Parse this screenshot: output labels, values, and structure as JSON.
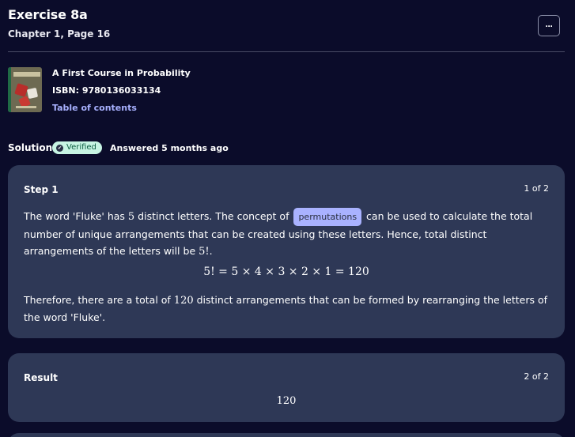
{
  "header": {
    "title": "Exercise 8a",
    "subtitle": "Chapter 1, Page 16",
    "more_label": "···"
  },
  "book": {
    "title": "A First Course in Probability",
    "isbn": "ISBN: 9780136033134",
    "toc_label": "Table of contents"
  },
  "solution": {
    "label": "Solution",
    "badge": "Verified",
    "answered": "Answered 5 months ago"
  },
  "step1": {
    "title": "Step 1",
    "count": "1 of 2",
    "p1_a": "The word 'Fluke' has ",
    "p1_num": "5",
    "p1_b": " distinct letters. The concept of ",
    "chip": "permutations",
    "p1_c": " can be used to calculate the total number of unique arrangements that can be created using these letters. Hence, total distinct arrangements of the letters will be ",
    "p1_fact": "5!",
    "p1_end": ".",
    "equation": "5! = 5 × 4 × 3 × 2 × 1 = 120",
    "p2_a": "Therefore, there are a total of ",
    "p2_num": "120",
    "p2_b": " distinct arrangements that can be formed by rearranging the letters of the word 'Fluke'."
  },
  "result": {
    "title": "Result",
    "count": "2 of 2",
    "value": "120"
  },
  "colors": {
    "background": "#0b0c2a",
    "card": "#2e3856",
    "accent_link": "#a8b1ff",
    "chip": "#a9b2ff",
    "verified_bg": "#c7f4e3"
  }
}
